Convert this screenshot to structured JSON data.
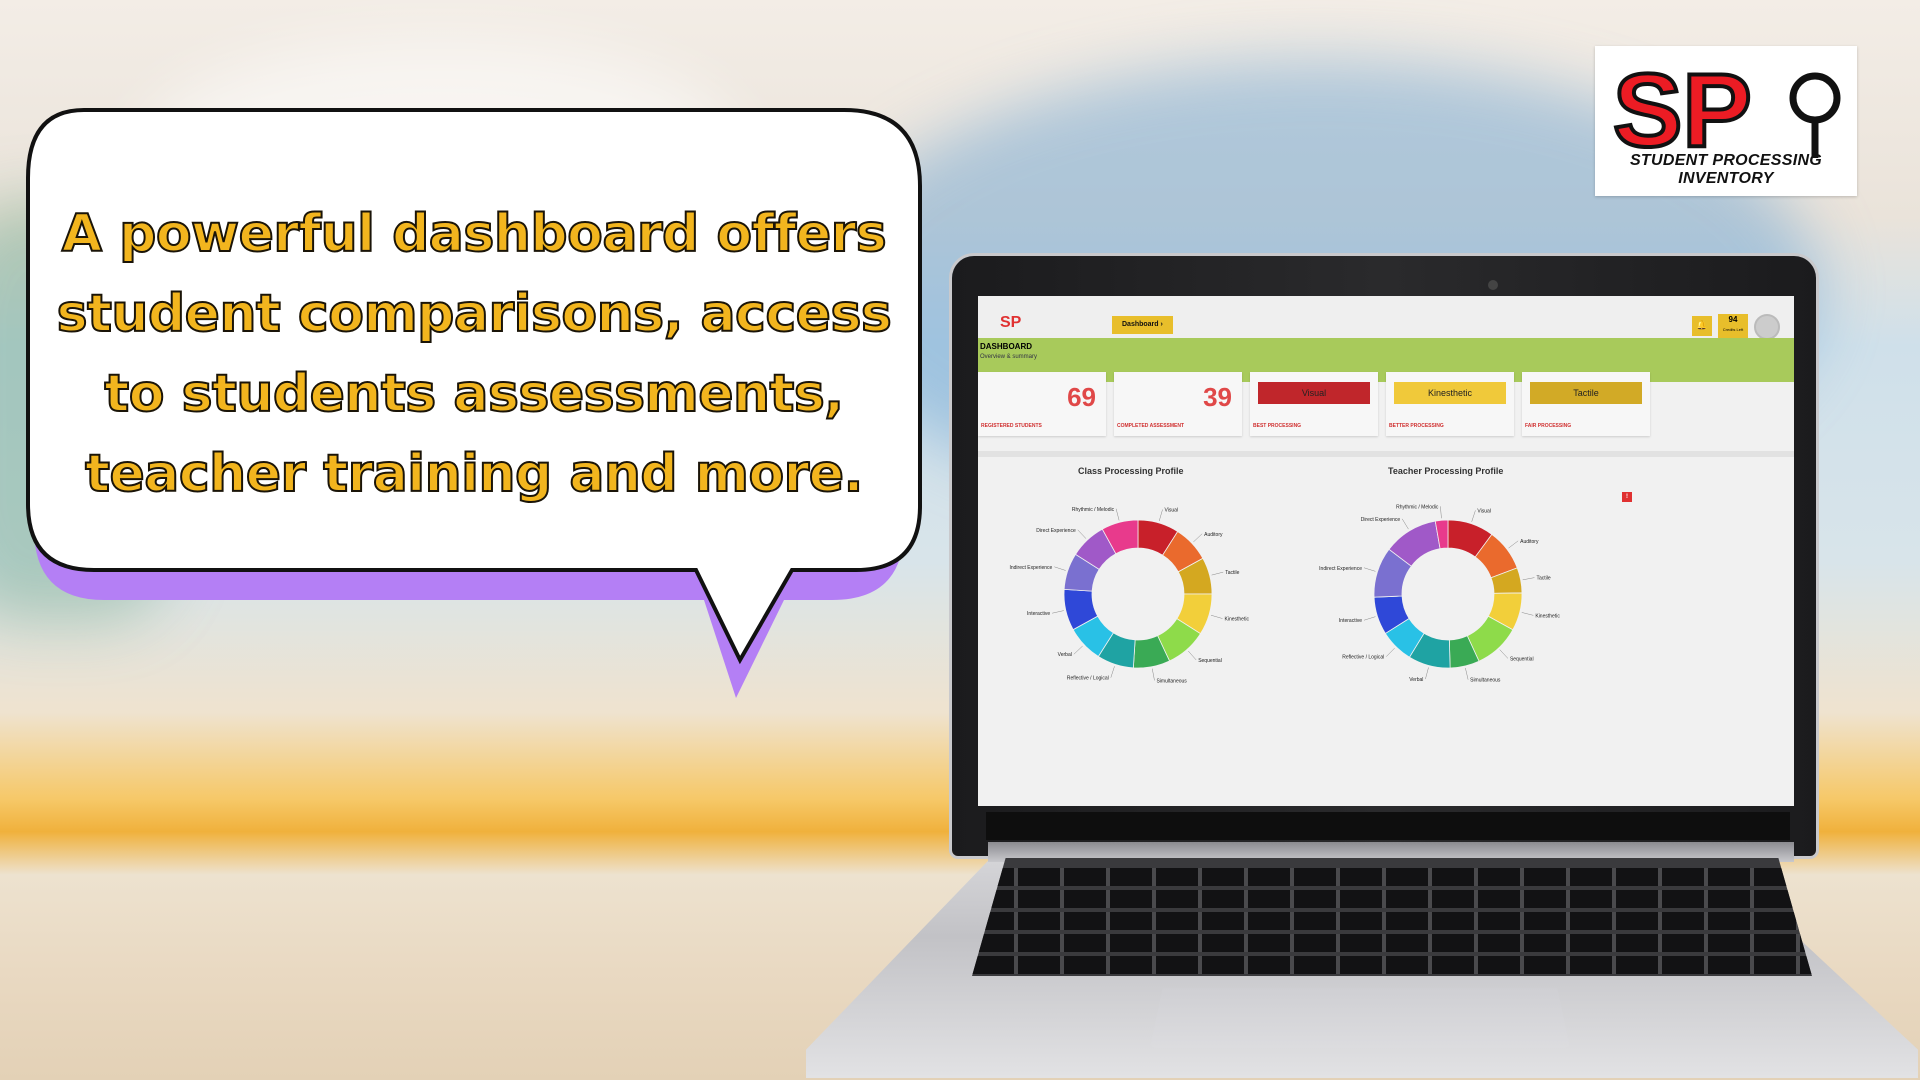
{
  "headline": "A powerful dashboard offers student comparisons, access to students assessments, teacher training and more.",
  "logo": {
    "mark": "SP",
    "subtitle": "STUDENT PROCESSING INVENTORY"
  },
  "dashboard": {
    "brand": "SP",
    "breadcrumb": "Dashboard",
    "credits": {
      "value": "94",
      "label": "Credits Left"
    },
    "banner": {
      "title": "DASHBOARD",
      "subtitle": "Overview & summary"
    },
    "cards": [
      {
        "value": "69",
        "label": "REGISTERED STUDENTS"
      },
      {
        "value": "39",
        "label": "COMPLETED ASSESSMENT"
      },
      {
        "pill": "Visual",
        "label": "BEST PROCESSING",
        "color": "#c0262b"
      },
      {
        "pill": "Kinesthetic",
        "label": "BETTER PROCESSING",
        "color": "#f0c93a"
      },
      {
        "pill": "Tactile",
        "label": "FAIR PROCESSING",
        "color": "#d2aa26"
      }
    ],
    "alert_badge": "!",
    "charts": [
      {
        "title": "Class Processing Profile",
        "labels": [
          "Visual",
          "Auditory",
          "Tactile",
          "Kinesthetic",
          "Sequential",
          "Simultaneous",
          "Reflective / Logical",
          "Verbal",
          "Interactive",
          "Indirect Experience",
          "Direct Experience",
          "Rhythmic / Melodic"
        ],
        "colors": [
          "#c8202a",
          "#ea6a2d",
          "#d4a820",
          "#f2cf3a",
          "#8edb4a",
          "#3aaa55",
          "#1fa3a3",
          "#29c1e6",
          "#2f48d8",
          "#7a70d0",
          "#a059c8",
          "#e83a8c"
        ],
        "values": [
          9,
          8,
          8,
          9,
          9,
          8,
          8,
          8,
          9,
          8,
          8,
          8
        ]
      },
      {
        "title": "Teacher Processing Profile",
        "labels": [
          "Visual",
          "Auditory",
          "Tactile",
          "Kinesthetic",
          "Sequential",
          "Simultaneous",
          "Verbal",
          "Reflective / Logical",
          "Interactive",
          "Indirect Experience",
          "Direct Experience",
          "Rhythmic / Melodic"
        ],
        "colors": [
          "#c8202a",
          "#ea6a2d",
          "#d4a820",
          "#f2cf3a",
          "#8edb4a",
          "#3aaa55",
          "#1fa3a3",
          "#29c1e6",
          "#2f48d8",
          "#7a70d0",
          "#a059c8",
          "#e83a8c"
        ],
        "values": [
          11,
          10,
          6,
          9,
          11,
          7,
          10,
          8,
          9,
          12,
          13,
          3
        ]
      }
    ]
  }
}
